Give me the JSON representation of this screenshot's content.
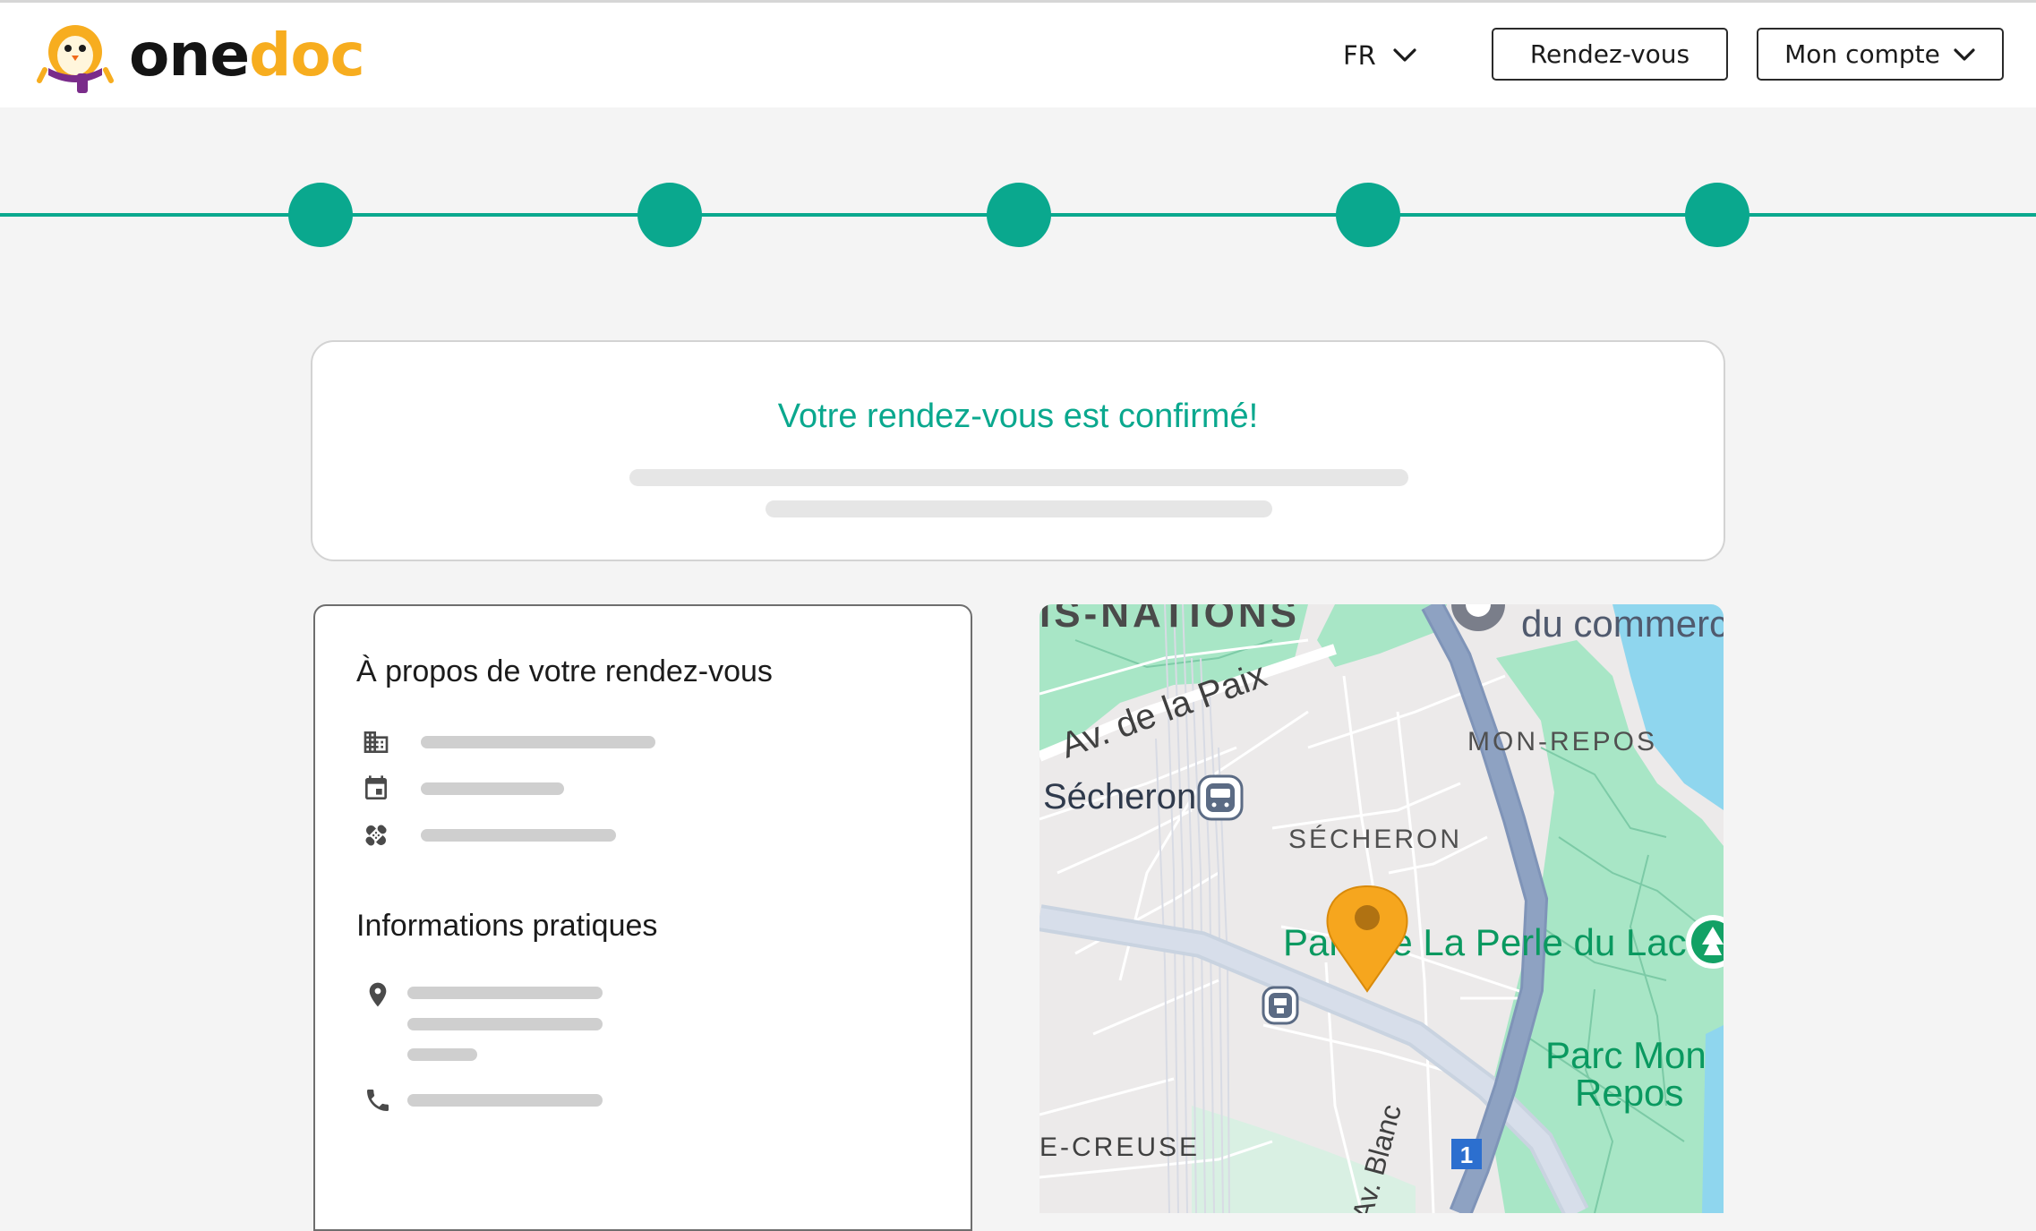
{
  "header": {
    "logo": {
      "part1": "one",
      "part2": "doc",
      "colors": {
        "dark": "#141414",
        "accent": "#f7ad1f"
      }
    },
    "language": "FR",
    "appointments_button": "Rendez-vous",
    "account_button": "Mon compte"
  },
  "stepper": {
    "total_steps": 5,
    "completed_steps": 5,
    "color": "#0aa88e"
  },
  "confirmation": {
    "title": "Votre rendez-vous est confirmé!"
  },
  "details": {
    "appointment_title": "À propos de votre rendez-vous",
    "appointment_rows": [
      "building-icon",
      "calendar-icon",
      "bandage-icon"
    ],
    "practical_title": "Informations pratiques",
    "practical_rows": [
      "location-pin-icon",
      "phone-icon"
    ]
  },
  "map": {
    "labels": {
      "nations": "IS-NATIONS",
      "commerce": "du commerc",
      "av_paix": "Av. de la Paix",
      "mon_repos": "MON-REPOS",
      "secheron_station": "Sécheron",
      "secheron_district": "SÉCHERON",
      "parc_perle": "Parc de La Perle du Lac",
      "parc_mon": "Parc Mon",
      "repos": "Repos",
      "creuse": "E-CREUSE",
      "av_blanc": "Av. Blanc",
      "route_number": "1"
    },
    "colors": {
      "park": "#a8e6c6",
      "water": "#8fd6ee",
      "road": "#c9d3e0",
      "highway": "#8ea2c2",
      "pin": "#f6a61e"
    }
  }
}
